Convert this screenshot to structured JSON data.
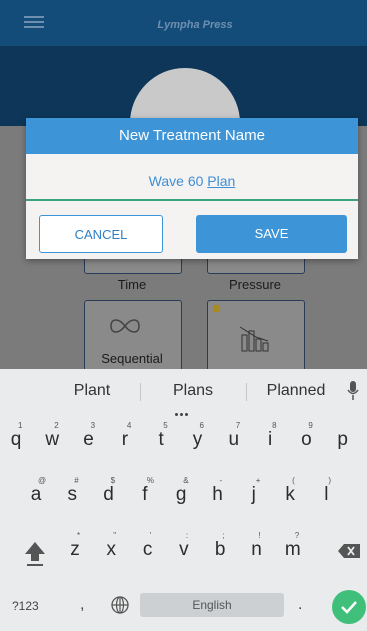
{
  "app": {
    "logo_text": "Lympha Press"
  },
  "tiles": {
    "time_label": "Time",
    "pressure_label": "Pressure",
    "sequential_label": "Sequential"
  },
  "dialog": {
    "title": "New Treatment Name",
    "input_prefix": "Wave 60",
    "input_underlined": "Plan",
    "cancel_label": "CANCEL",
    "save_label": "SAVE"
  },
  "keyboard": {
    "suggestions": [
      "Plant",
      "Plans",
      "Planned"
    ],
    "row1": [
      {
        "k": "q",
        "h": "1"
      },
      {
        "k": "w",
        "h": "2"
      },
      {
        "k": "e",
        "h": "3"
      },
      {
        "k": "r",
        "h": "4"
      },
      {
        "k": "t",
        "h": "5"
      },
      {
        "k": "y",
        "h": "6"
      },
      {
        "k": "u",
        "h": "7"
      },
      {
        "k": "i",
        "h": "8"
      },
      {
        "k": "o",
        "h": "9"
      },
      {
        "k": "p",
        "h": ""
      }
    ],
    "row2": [
      {
        "k": "a",
        "h": "@"
      },
      {
        "k": "s",
        "h": "#"
      },
      {
        "k": "d",
        "h": "$"
      },
      {
        "k": "f",
        "h": "%"
      },
      {
        "k": "g",
        "h": "&"
      },
      {
        "k": "h",
        "h": "-"
      },
      {
        "k": "j",
        "h": "+"
      },
      {
        "k": "k",
        "h": "("
      },
      {
        "k": "l",
        "h": ")"
      }
    ],
    "row3": [
      {
        "k": "z",
        "h": "*"
      },
      {
        "k": "x",
        "h": "\""
      },
      {
        "k": "c",
        "h": "'"
      },
      {
        "k": "v",
        "h": ":"
      },
      {
        "k": "b",
        "h": ";"
      },
      {
        "k": "n",
        "h": "!"
      },
      {
        "k": "m",
        "h": "?"
      }
    ],
    "num_label": "?123",
    "comma_label": ",",
    "space_label": "English",
    "period_label": "."
  }
}
